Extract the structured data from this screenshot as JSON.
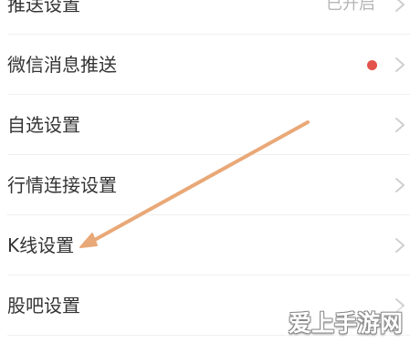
{
  "settings_list": {
    "items": [
      {
        "label": "推送设置",
        "status": "已开启"
      },
      {
        "label": "微信消息推送",
        "has_red_dot": true,
        "red_dot_color": "#e2534c"
      },
      {
        "label": "自选设置"
      },
      {
        "label": "行情连接设置"
      },
      {
        "label": "K线设置"
      },
      {
        "label": "股吧设置"
      }
    ],
    "chevron_icon": "chevron-right-icon"
  },
  "annotation": {
    "type": "arrow",
    "color": "#e9a877",
    "points_to": "K线设置"
  },
  "watermark": {
    "text": "爱上手游网"
  }
}
